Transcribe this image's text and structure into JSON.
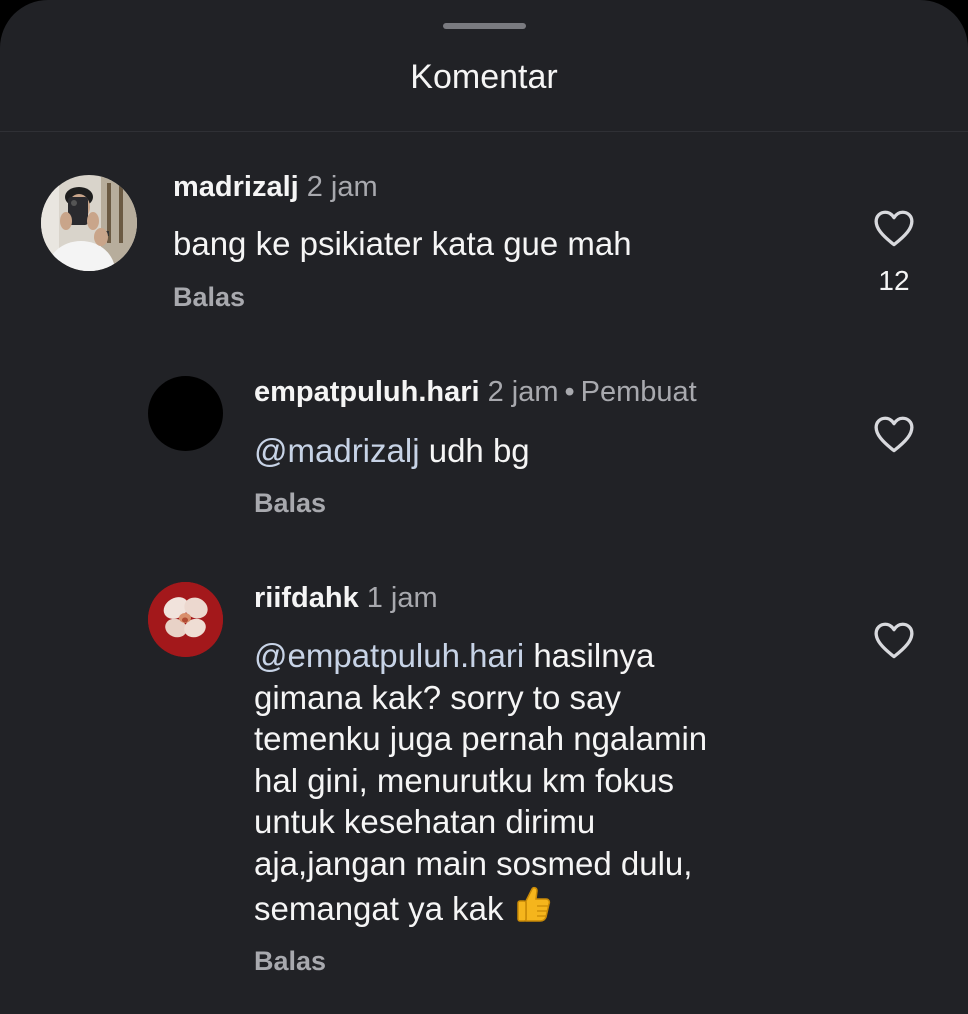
{
  "header": {
    "title": "Komentar"
  },
  "comments": [
    {
      "username": "madrizalj",
      "time": "2 jam",
      "text": "bang ke psikiater kata gue mah",
      "reply_label": "Balas",
      "likes": "12",
      "avatar_icon": "profile-photo"
    },
    {
      "username": "empatpuluh.hari",
      "time": "2 jam",
      "separator": "•",
      "badge": "Pembuat",
      "mention": "@madrizalj",
      "text": " udh bg",
      "reply_label": "Balas",
      "avatar_icon": "black-circle"
    },
    {
      "username": "riifdahk",
      "time": "1 jam",
      "mention": "@empatpuluh.hari",
      "text_lines": [
        " hasilnya",
        "gimana kak? sorry to say",
        "temenku juga pernah ngalamin",
        "hal gini, menurutku km fokus",
        "untuk kesehatan dirimu",
        "aja,jangan main sosmed dulu,",
        "semangat ya kak"
      ],
      "emoji": "thumbs-up-icon",
      "reply_label": "Balas",
      "avatar_icon": "orchid-photo"
    }
  ],
  "colors": {
    "background": "#212226",
    "text_primary": "#f5f5f5",
    "text_secondary": "#a8a9ae",
    "mention": "#c7d3e6"
  }
}
